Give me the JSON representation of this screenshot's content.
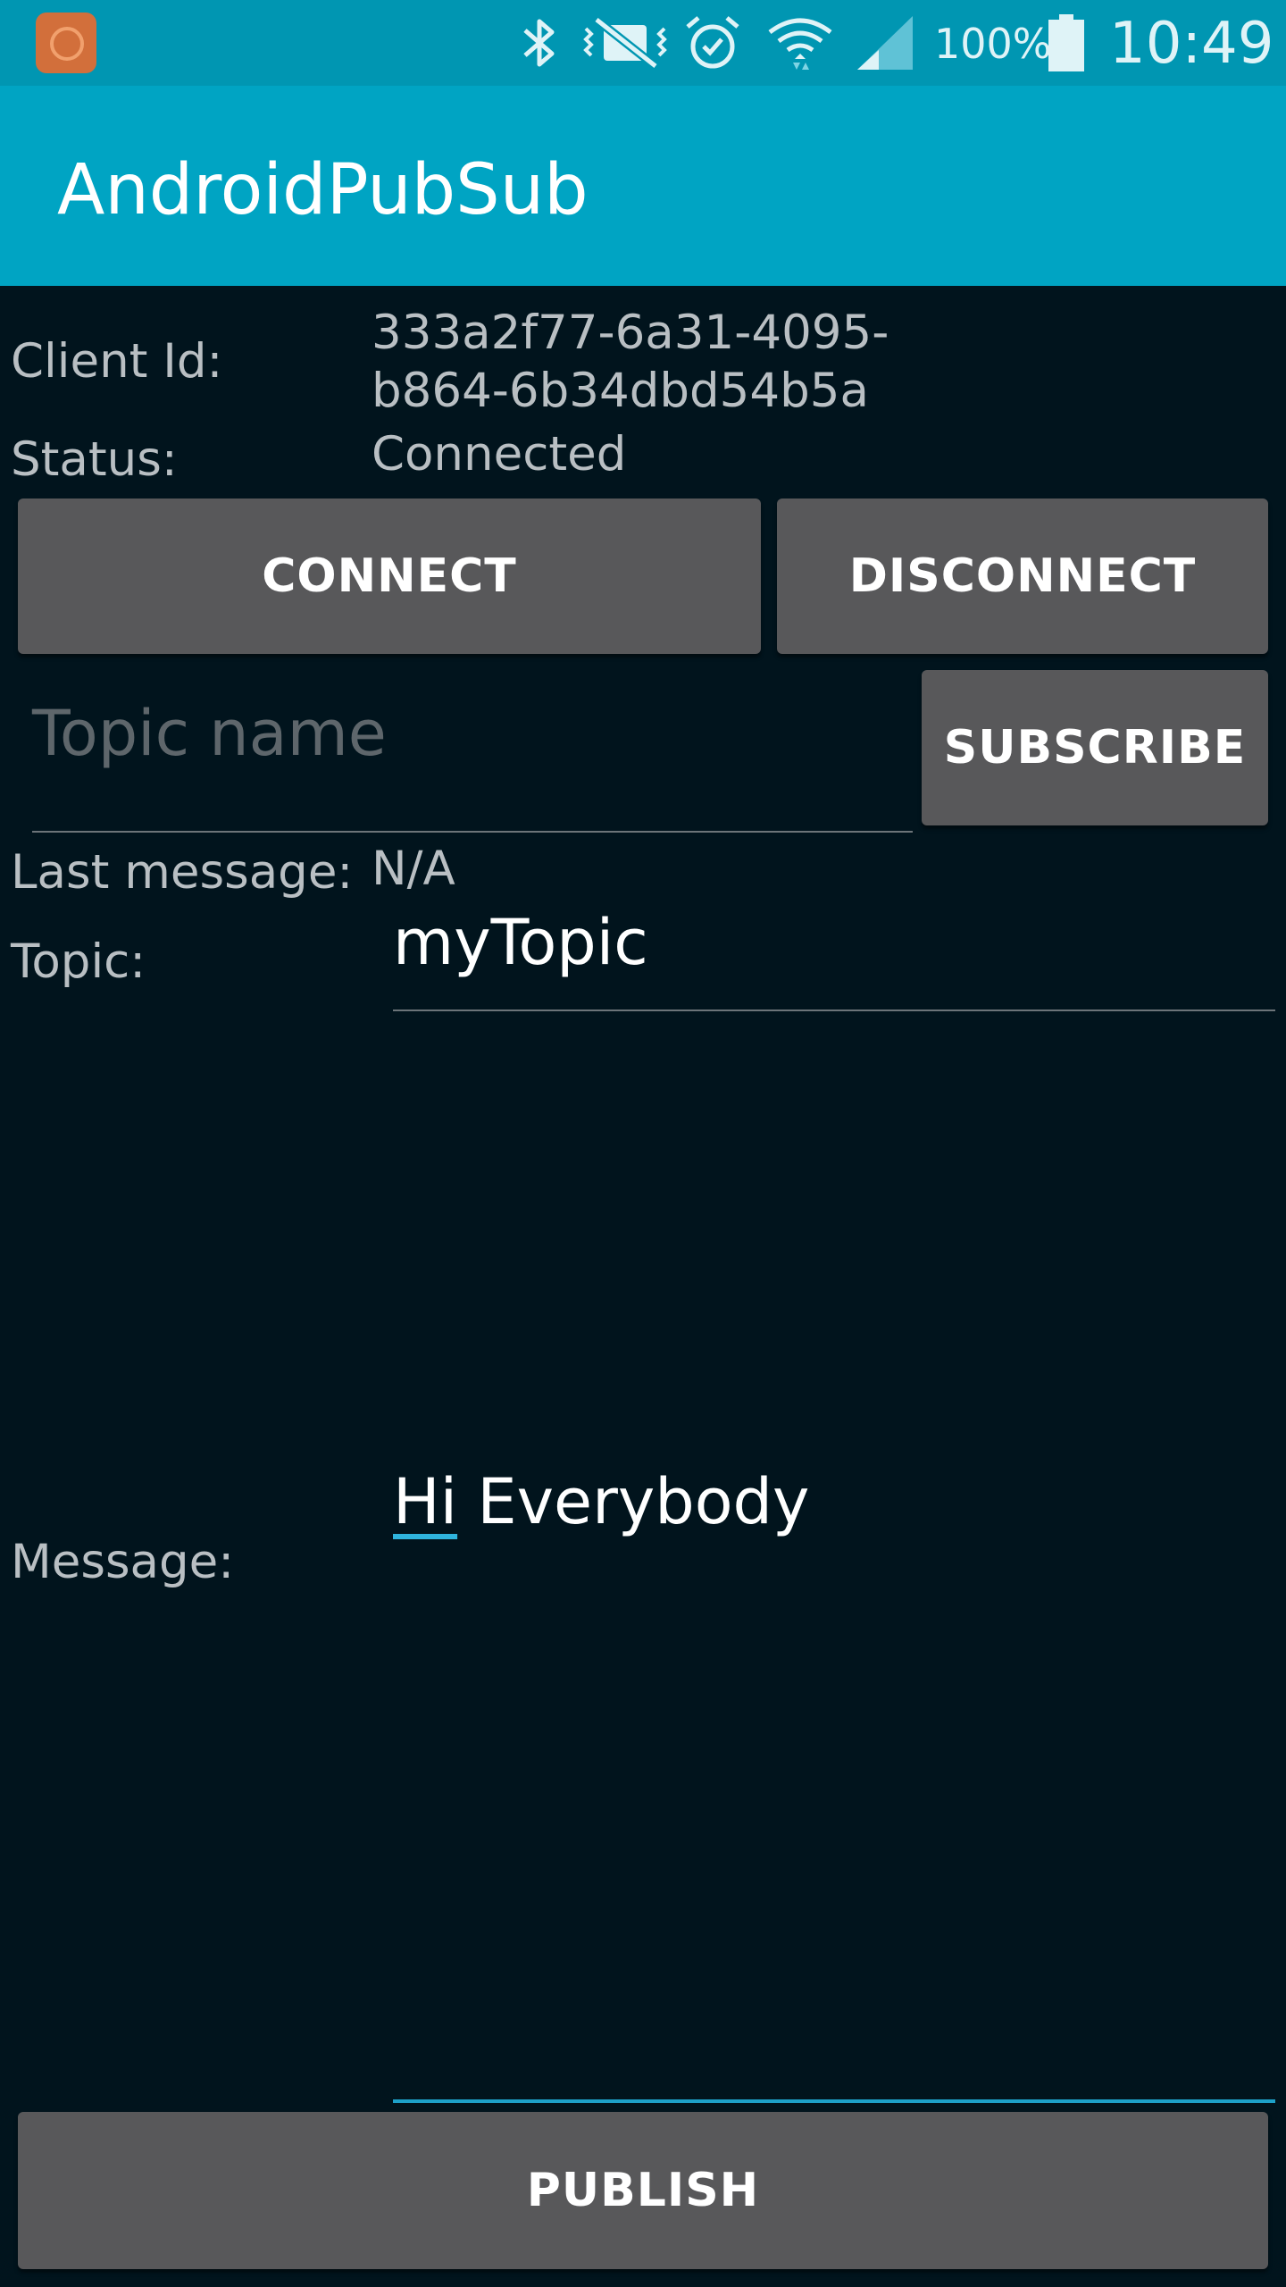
{
  "status_bar": {
    "battery_percent": "100%",
    "time": "10:49",
    "icons": [
      "app-notification-icon",
      "bluetooth-icon",
      "vibrate-mute-icon",
      "alarm-icon",
      "wifi-icon",
      "cell-signal-icon",
      "battery-icon"
    ]
  },
  "app_bar": {
    "title": "AndroidPubSub"
  },
  "client": {
    "id_label": "Client Id:",
    "id_line1": "333a2f77-6a31-4095-",
    "id_line2": "b864-6b34dbd54b5a",
    "status_label": "Status:",
    "status_value": "Connected"
  },
  "buttons": {
    "connect": "CONNECT",
    "disconnect": "DISCONNECT",
    "subscribe": "SUBSCRIBE",
    "publish": "PUBLISH"
  },
  "subscribe": {
    "topic_placeholder": "Topic name",
    "topic_value": "",
    "last_message_label": "Last message:",
    "last_message_value": "N/A"
  },
  "publish": {
    "topic_label": "Topic:",
    "topic_value": "myTopic",
    "message_label": "Message:",
    "message_word1": "Hi",
    "message_rest": " Everybody"
  },
  "colors": {
    "status_bar": "#0096b2",
    "app_bar": "#00a4c3",
    "background": "#01141d",
    "button": "#58585a",
    "accent": "#1da1c9"
  }
}
